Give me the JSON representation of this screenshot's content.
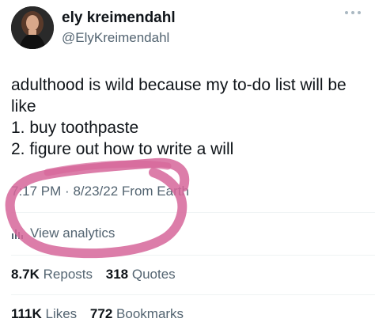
{
  "user": {
    "display_name": "ely kreimendahl",
    "handle": "@ElyKreimendahl"
  },
  "tweet": {
    "lines": [
      "adulthood is wild because my to-do list will be",
      "like",
      "1. buy toothpaste",
      "2. figure out how to write a will"
    ],
    "time": "7:17 PM",
    "separator": "·",
    "date": "8/23/22",
    "source": "From Earth"
  },
  "analytics": {
    "label": "View analytics",
    "icon": "bar-chart-icon"
  },
  "stats": {
    "reposts_count": "8.7K",
    "reposts_label": "Reposts",
    "quotes_count": "318",
    "quotes_label": "Quotes",
    "likes_count": "111K",
    "likes_label": "Likes",
    "bookmarks_count": "772",
    "bookmarks_label": "Bookmarks"
  },
  "colors": {
    "text": "#0f1419",
    "secondary": "#536471",
    "divider": "#eff3f4",
    "scribble": "#d6669a"
  }
}
